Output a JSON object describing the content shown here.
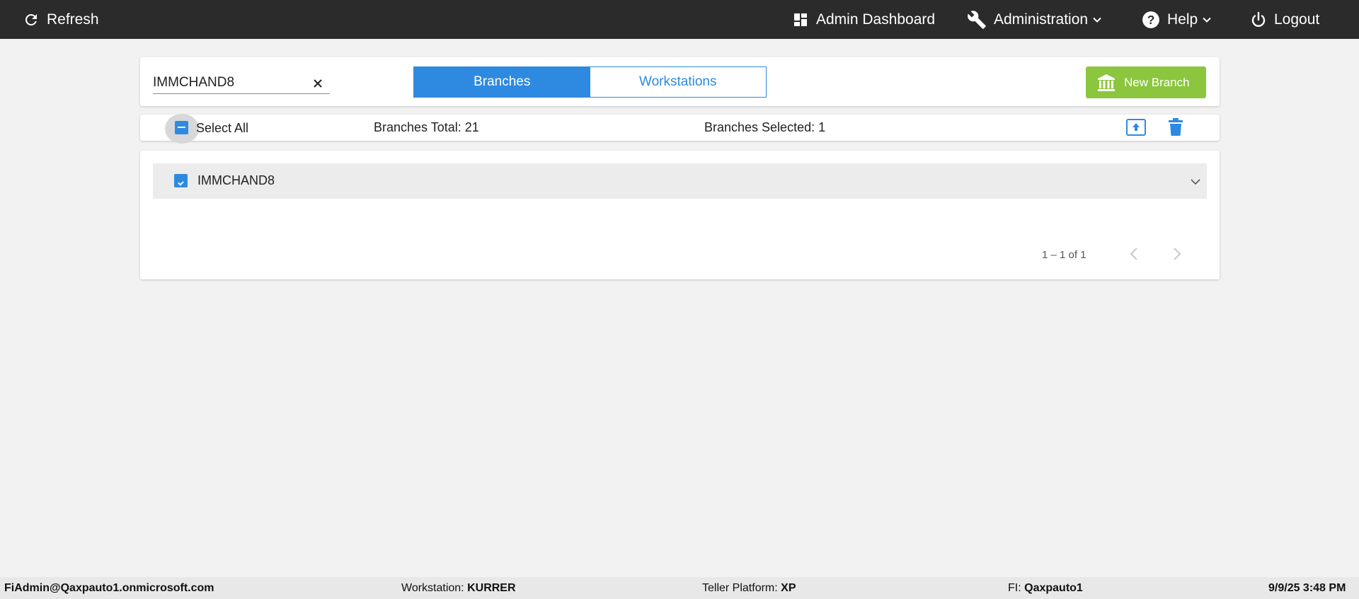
{
  "topbar": {
    "refresh_label": "Refresh",
    "admin_dashboard_label": "Admin Dashboard",
    "administration_label": "Administration",
    "help_label": "Help",
    "logout_label": "Logout",
    "icons": {
      "refresh": "refresh-icon",
      "dashboard": "dashboard-grid-icon",
      "administration": "wrench-icon",
      "help": "help-circle-icon",
      "logout": "power-icon"
    }
  },
  "search": {
    "value": "IMMCHAND8",
    "clear_icon": "close-icon"
  },
  "tabs": [
    {
      "label": "Branches",
      "active": true
    },
    {
      "label": "Workstations",
      "active": false
    }
  ],
  "new_branch": {
    "label": "New Branch",
    "icon": "bank-icon",
    "color": "#8cc63e"
  },
  "select_bar": {
    "select_all_label": "Select All",
    "branches_total_label": "Branches Total: 21",
    "branches_selected_label": "Branches Selected: 1",
    "upload_icon": "upload-icon",
    "delete_icon": "trash-icon"
  },
  "list": {
    "rows": [
      {
        "label": "IMMCHAND8",
        "selected": true
      }
    ]
  },
  "pager": {
    "range_label": "1 – 1 of 1"
  },
  "footer": {
    "user": "FiAdmin@Qaxpauto1.onmicrosoft.com",
    "workstation_label": "Workstation:",
    "workstation_value": "KURRER",
    "platform_label": "Teller Platform:",
    "platform_value": "XP",
    "fi_label": "FI:",
    "fi_value": "Qaxpauto1",
    "datetime": "9/9/25 3:48 PM"
  },
  "colors": {
    "accent": "#2e8ae0",
    "topbar_bg": "#2b2b2b",
    "page_bg": "#f2f2f2"
  }
}
